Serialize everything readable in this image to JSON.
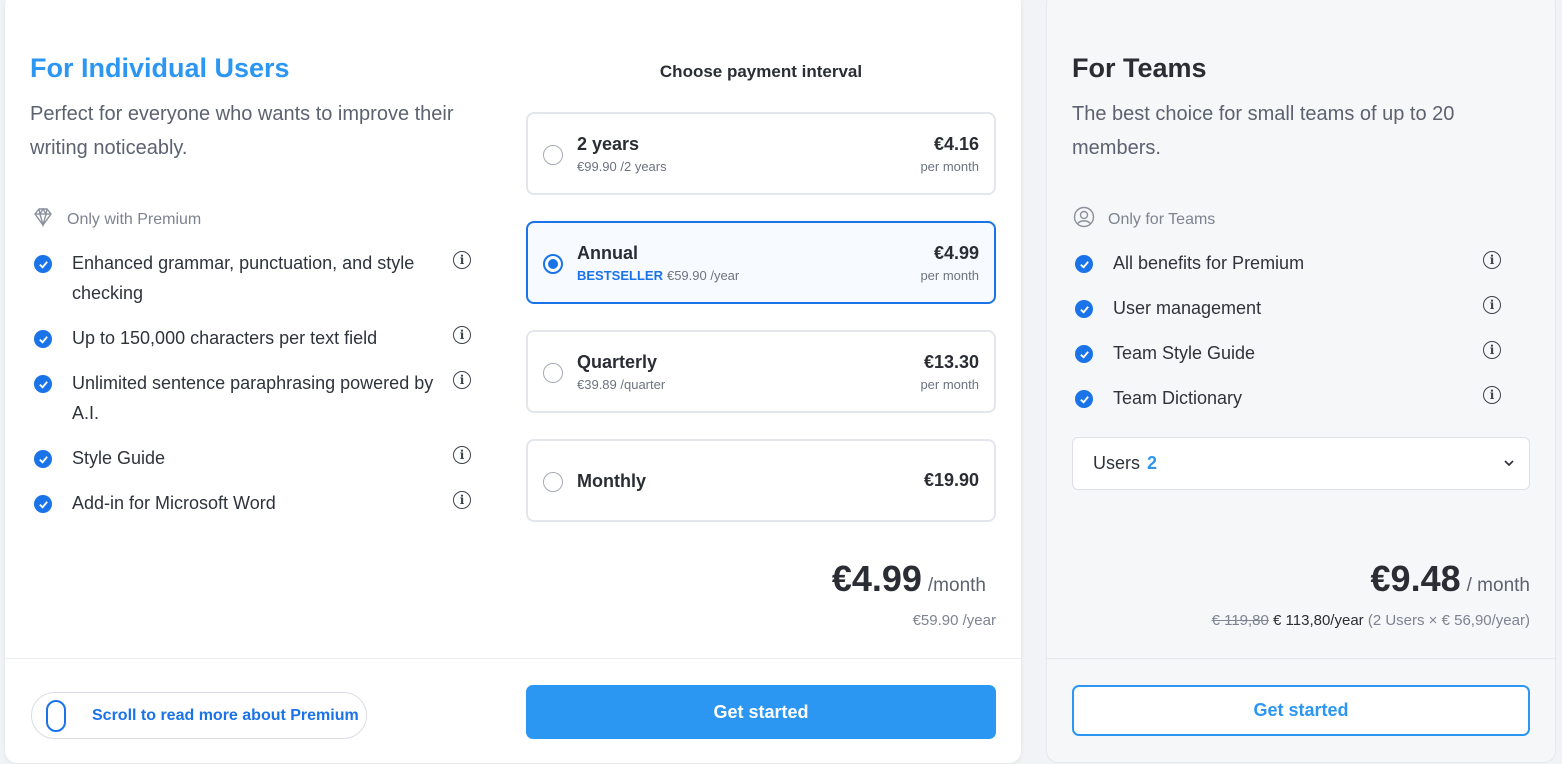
{
  "individual": {
    "title": "For Individual Users",
    "subtitle": "Perfect for everyone who wants to improve their writing noticeably.",
    "only_label": "Only with Premium",
    "features": [
      {
        "text": "Enhanced grammar, punctuation, and style checking"
      },
      {
        "text": "Up to 150,000 characters per text field"
      },
      {
        "text": "Unlimited sentence paraphrasing powered by A.I."
      },
      {
        "text": "Style Guide"
      },
      {
        "text": "Add-in for Microsoft Word"
      }
    ],
    "choose_label": "Choose payment interval",
    "plans": [
      {
        "name": "2 years",
        "sub": "€99.90 /2 years",
        "price": "€4.16",
        "per": "per month",
        "selected": false
      },
      {
        "name": "Annual",
        "badge": "BESTSELLER",
        "sub": "€59.90 /year",
        "price": "€4.99",
        "per": "per month",
        "selected": true
      },
      {
        "name": "Quarterly",
        "sub": "€39.89 /quarter",
        "price": "€13.30",
        "per": "per month",
        "selected": false
      },
      {
        "name": "Monthly",
        "price": "€19.90",
        "selected": false
      }
    ],
    "total": {
      "amount": "€4.99",
      "unit": "/month",
      "sub": "€59.90 /year"
    },
    "scroll_label": "Scroll to read more about Premium",
    "cta": "Get started"
  },
  "teams": {
    "title": "For Teams",
    "subtitle": "The best choice for small teams of up to 20 members.",
    "only_label": "Only for Teams",
    "features": [
      {
        "text": "All benefits for Premium"
      },
      {
        "text": "User management"
      },
      {
        "text": "Team Style Guide"
      },
      {
        "text": "Team Dictionary"
      }
    ],
    "users_label": "Users",
    "users_value": "2",
    "total": {
      "amount": "€9.48",
      "unit": "/ month",
      "old_price": "€ 119,80",
      "new_price": "€ 113,80/year",
      "detail": "(2 Users × € 56,90/year)"
    },
    "cta": "Get started"
  },
  "colors": {
    "accent": "#2b97f3",
    "check": "#1a73e8"
  }
}
